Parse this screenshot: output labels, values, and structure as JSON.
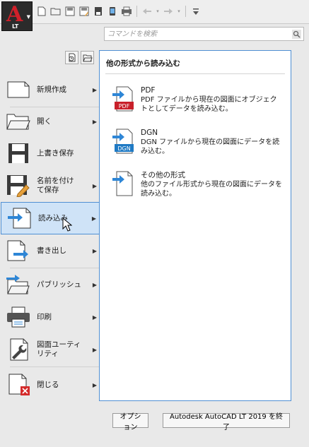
{
  "app": {
    "logo_letter": "A",
    "logo_sub": "LT"
  },
  "quick_access": {
    "icons": [
      "new-file-icon",
      "open-folder-icon",
      "save-icon",
      "save-as-icon",
      "export-icon",
      "publish-icon",
      "plot-icon",
      "undo-icon",
      "redo-icon",
      "customize-icon"
    ]
  },
  "search": {
    "placeholder": "コマンドを検索",
    "value": ""
  },
  "menu": {
    "items": [
      {
        "id": "new",
        "label": "新規作成",
        "has_submenu": true
      },
      {
        "id": "open",
        "label": "開く",
        "has_submenu": true
      },
      {
        "id": "save",
        "label": "上書き保存",
        "has_submenu": false
      },
      {
        "id": "saveas",
        "label": "名前を付け\nて保存",
        "has_submenu": true
      },
      {
        "id": "import",
        "label": "読み込み",
        "has_submenu": true
      },
      {
        "id": "export",
        "label": "書き出し",
        "has_submenu": true
      },
      {
        "id": "publish",
        "label": "パブリッシュ",
        "has_submenu": true
      },
      {
        "id": "print",
        "label": "印刷",
        "has_submenu": true
      },
      {
        "id": "utilities",
        "label": "図面ユーティ\nリティ",
        "has_submenu": true
      },
      {
        "id": "close",
        "label": "閉じる",
        "has_submenu": true
      }
    ]
  },
  "panel": {
    "title": "他の形式から読み込む",
    "entries": [
      {
        "title": "PDF",
        "desc": "PDF ファイルから現在の図面にオブジェクトとしてデータを読み込む。",
        "badge": "PDF"
      },
      {
        "title": "DGN",
        "desc": "DGN ファイルから現在の図面にデータを読み込む。",
        "badge": "DGN"
      },
      {
        "title": "その他の形式",
        "desc": "他のファイル形式から現在の図面にデータを読み込む。",
        "badge": ""
      }
    ]
  },
  "buttons": {
    "options": "オプション",
    "exit": "Autodesk AutoCAD LT 2019 を終了"
  },
  "colors": {
    "accent": "#4f8fd3",
    "active_bg": "#cfe3f7",
    "logo_red": "#d0202a",
    "pdf_red": "#c8202a",
    "dgn_blue": "#1f7ac4"
  }
}
